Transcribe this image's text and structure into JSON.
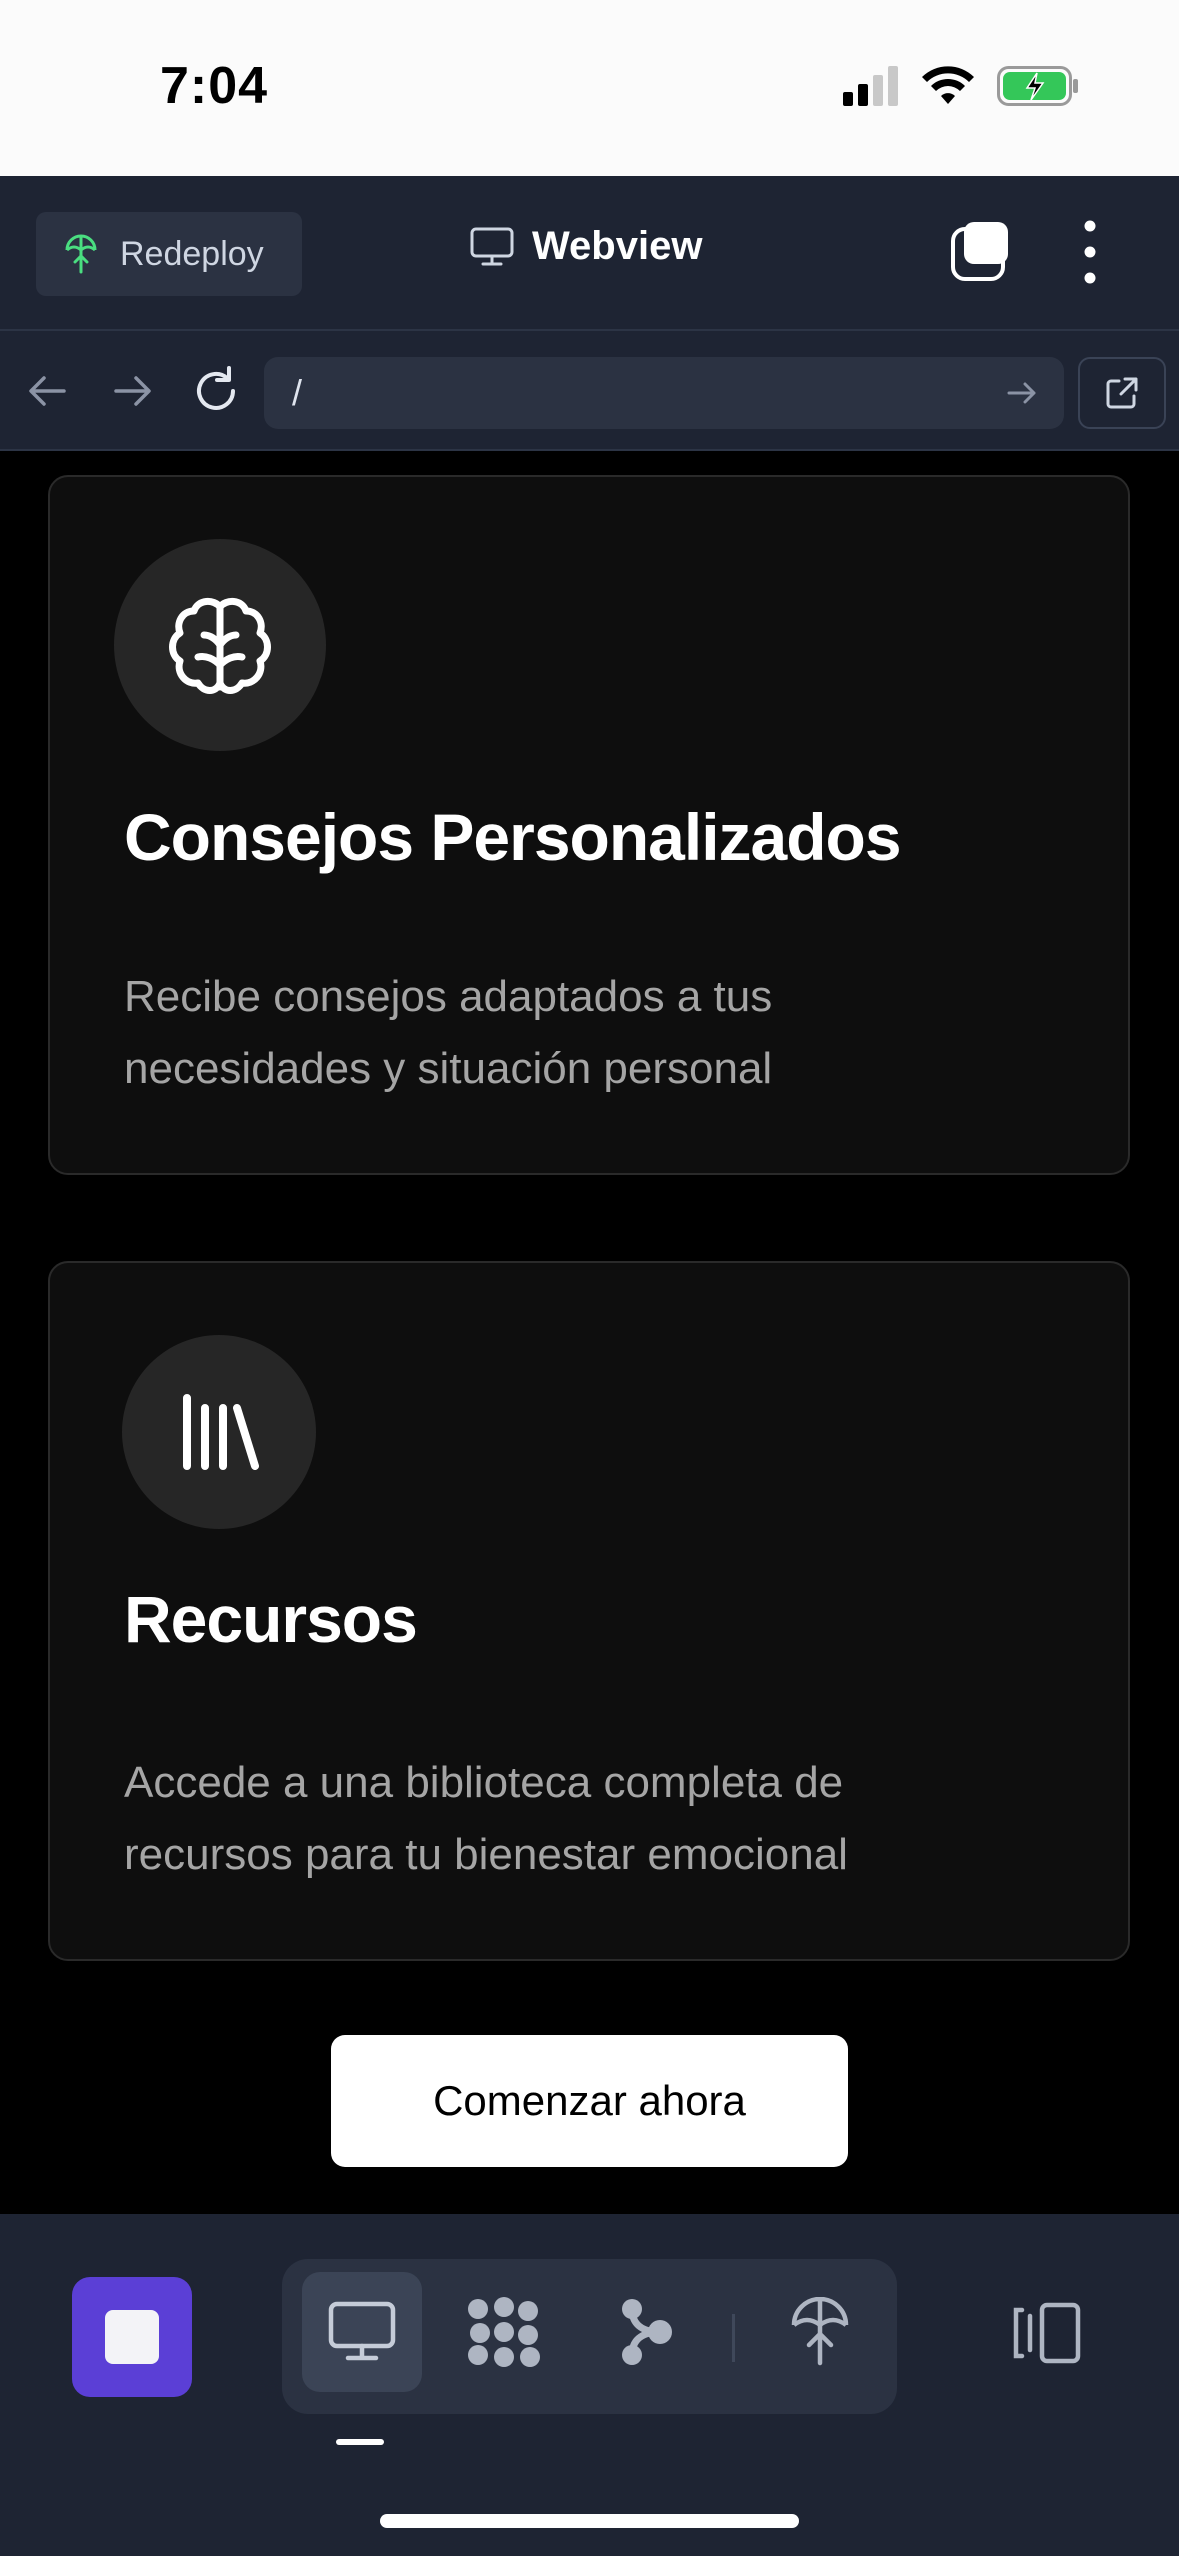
{
  "status_bar": {
    "time": "7:04"
  },
  "topbar": {
    "redeploy_label": "Redeploy",
    "title": "Webview"
  },
  "navbar": {
    "url": "/"
  },
  "cards": [
    {
      "title": "Consejos Personalizados",
      "description": "Recibe consejos adaptados a tus necesidades y situación personal",
      "icon": "brain-icon"
    },
    {
      "title": "Recursos",
      "description": "Accede a una biblioteca completa de recursos para tu bienestar emocional",
      "icon": "library-icon"
    }
  ],
  "cta": {
    "label": "Comenzar ahora"
  },
  "bottom_bar": {
    "tools": [
      "monitor-icon",
      "dots-grid-icon",
      "branch-icon",
      "deploy-icon"
    ],
    "active_tool": "monitor-icon"
  },
  "colors": {
    "chrome_bg": "#1e2433",
    "accent_stop": "#5b3fd6",
    "card_bg": "#0e0e0e",
    "redeploy_icon": "#4ade80",
    "battery_charging": "#4ade80"
  }
}
